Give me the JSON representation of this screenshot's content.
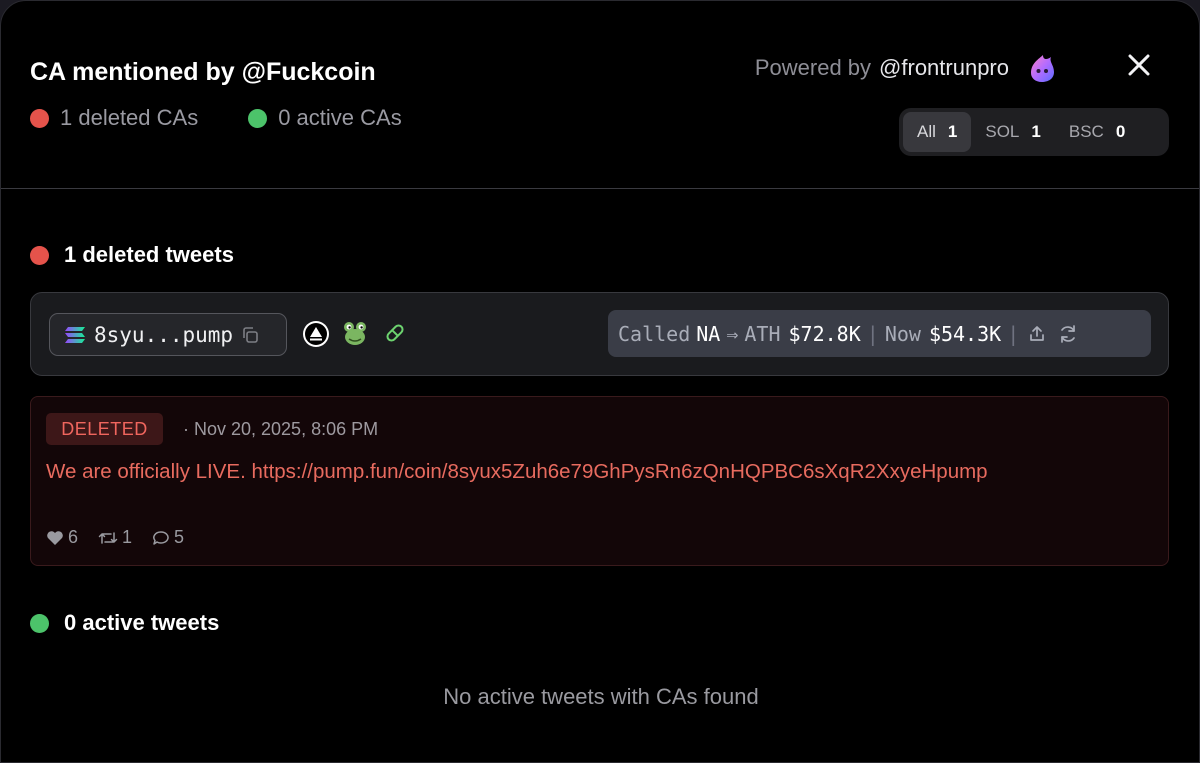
{
  "header": {
    "title": "CA mentioned by @Fuckcoin",
    "deleted_cas": "1 deleted CAs",
    "active_cas": "0 active CAs",
    "powered_prefix": "Powered by",
    "powered_handle": "@frontrunpro",
    "close_icon": "close-icon"
  },
  "filters": [
    {
      "label": "All",
      "count": "1",
      "active": true
    },
    {
      "label": "SOL",
      "count": "1",
      "active": false
    },
    {
      "label": "BSC",
      "count": "0",
      "active": false
    }
  ],
  "deleted_section": {
    "heading": "1 deleted tweets",
    "token": {
      "chain_icon": "solana-icon",
      "ca_short": "8syu...pump",
      "called_label": "Called",
      "called_value": "NA",
      "arrow": "⇒",
      "ath_label": "ATH",
      "ath_value": "$72.8K",
      "now_label": "Now",
      "now_value": "$54.3K"
    },
    "tweet": {
      "badge": "DELETED",
      "time": "· Nov 20, 2025, 8:06 PM",
      "text": "We are officially LIVE. https://pump.fun/coin/8syux5Zuh6e79GhPysRn6zQnHQPBC6sXqR2XxyeHpump",
      "likes": "6",
      "retweets": "1",
      "replies": "5"
    }
  },
  "active_section": {
    "heading": "0 active tweets",
    "empty_message": "No active tweets with CAs found"
  },
  "colors": {
    "deleted_red": "#e5534b",
    "active_green": "#4cc36a",
    "tweet_text": "#e86b5f"
  }
}
